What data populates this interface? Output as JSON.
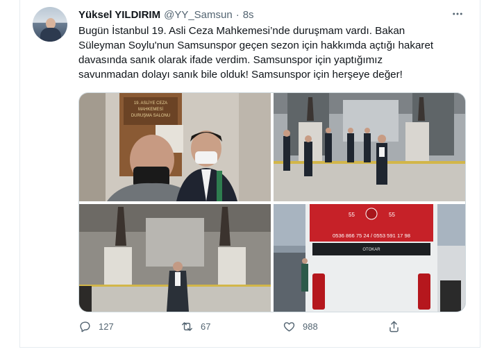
{
  "tweet": {
    "display_name": "Yüksel YILDIRIM",
    "handle": "@YY_Samsun",
    "separator": "·",
    "time": "8s",
    "more_icon": "more-horizontal-icon",
    "text_lines": [
      "Bugün İstanbul 19. Asli Ceza Mahkemesi’nde duruşmam vardı. Bakan",
      "Süleyman Soylu'nun Samsunspor geçen sezon için hakkımda açtığı hakaret",
      "davasında sanık olarak ifade verdim. Samsunspor için yaptığımız",
      "savunmadan dolayı sanık bile olduk! Samsunspor için herşeye değer!"
    ]
  },
  "photos": {
    "photo1": {
      "sign_lines": [
        "19. ASLİYE CEZA",
        "MAHKEMESİ",
        "DURUŞMA SALONU"
      ]
    },
    "photo4": {
      "emblem_left": "55",
      "emblem_right": "55",
      "phone": "0536 866 75 24 / 0553 591 17 98",
      "brand": "OTOKAR"
    }
  },
  "actions": {
    "reply_count": "127",
    "retweet_count": "67",
    "like_count": "988"
  },
  "colors": {
    "secondary_text": "#536471",
    "border": "#cfd9de",
    "bus_red": "#c62128"
  }
}
